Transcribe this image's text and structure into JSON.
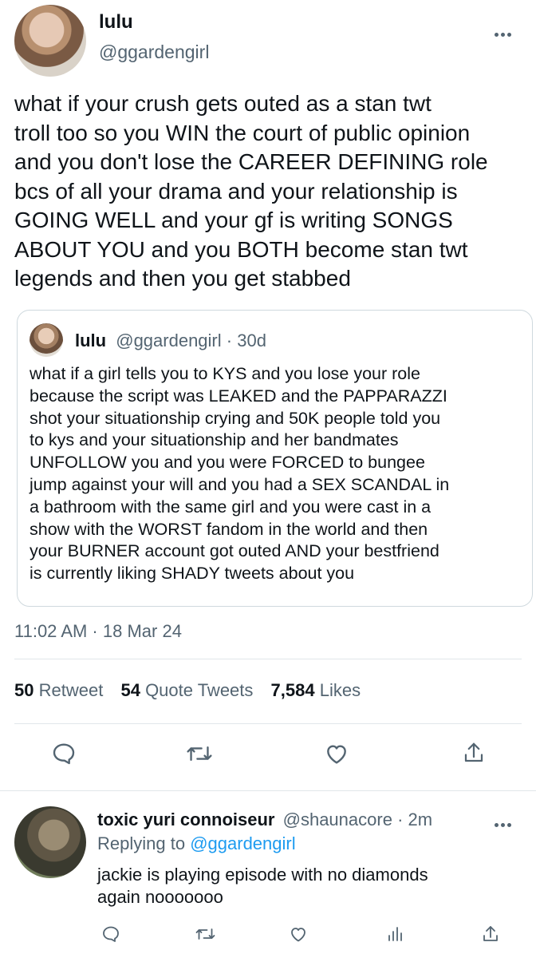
{
  "tweet": {
    "author_name": "lulu",
    "author_handle": "@ggardengirl",
    "text_lines": [
      "what if your crush gets outed as a stan twt",
      "troll too so you WIN the court of public opinion",
      "and you don't lose the CAREER DEFINING role",
      "bcs of all your drama and your relationship is",
      "GOING WELL and your gf is writing SONGS",
      "ABOUT YOU and you BOTH become stan twt",
      "legends and then you get stabbed"
    ],
    "timestamp": "11:02 AM · 18 Mar 24",
    "stats": {
      "retweets_count": "50",
      "retweets_label": "Retweet",
      "quotes_count": "54",
      "quotes_label": "Quote Tweets",
      "likes_count": "7,584",
      "likes_label": "Likes"
    }
  },
  "quoted_tweet": {
    "author_name": "lulu",
    "author_handle": "@ggardengirl",
    "age": "· 30d",
    "text_lines": [
      "what if a girl tells you to KYS and you lose your role",
      "because the script was LEAKED and the PAPPARAZZI",
      "shot your situationship crying and 50K people told you",
      "to kys and your situationship and her bandmates",
      "UNFOLLOW you and you were FORCED to bungee",
      "jump against your will and you had a SEX SCANDAL in",
      "a bathroom with the same girl and you were cast in a",
      "show with the WORST fandom in the world and then",
      "your BURNER account got outed AND your bestfriend",
      "is currently liking SHADY tweets about you"
    ]
  },
  "reply": {
    "author_name": "toxic yuri connoiseur",
    "author_handle": "@shaunacore",
    "age": "· 2m",
    "replying_prefix": "Replying to",
    "replying_to": "@ggardengirl",
    "text_lines": [
      "jackie is playing episode with no diamonds",
      "again nooooooo"
    ]
  },
  "icons": {
    "more": "more-icon",
    "reply": "reply-icon",
    "retweet": "retweet-icon",
    "like": "like-icon",
    "share": "share-icon",
    "analytics": "analytics-icon"
  },
  "colors": {
    "text": "#0f1419",
    "muted": "#536471",
    "link": "#1d9bf0",
    "border": "#cfd9de"
  }
}
